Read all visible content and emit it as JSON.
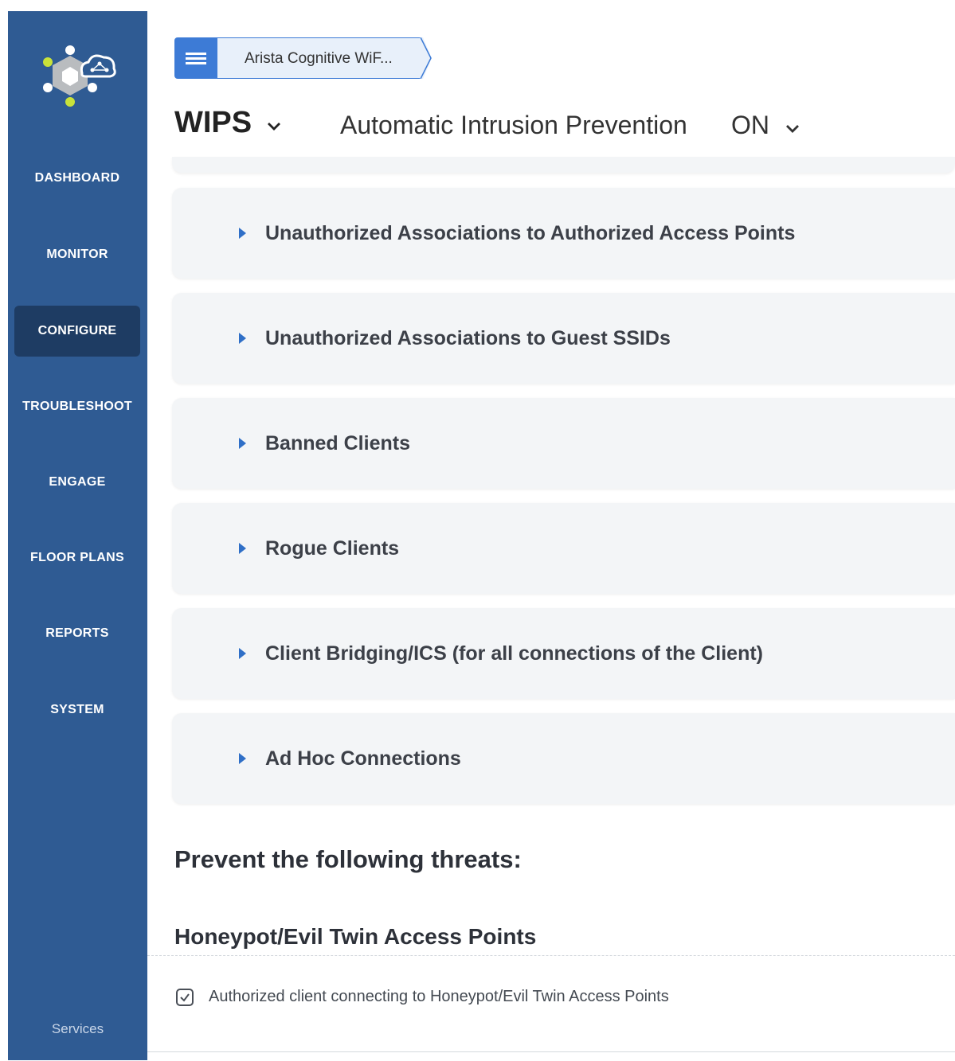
{
  "sidebar": {
    "logo_icon": "cloud-network-hexagon-logo",
    "items": [
      {
        "label": "DASHBOARD",
        "active": false
      },
      {
        "label": "MONITOR",
        "active": false
      },
      {
        "label": "CONFIGURE",
        "active": true
      },
      {
        "label": "TROUBLESHOOT",
        "active": false
      },
      {
        "label": "ENGAGE",
        "active": false
      },
      {
        "label": "FLOOR PLANS",
        "active": false
      },
      {
        "label": "REPORTS",
        "active": false
      },
      {
        "label": "SYSTEM",
        "active": false
      }
    ],
    "footer": "Services"
  },
  "breadcrumb": {
    "menu_icon": "hamburger-icon",
    "label": "Arista Cognitive WiF..."
  },
  "header": {
    "title": "WIPS",
    "subtitle": "Automatic Intrusion Prevention",
    "status": "ON"
  },
  "panels": [
    {
      "label": "Unauthorized Associations to Authorized Access Points"
    },
    {
      "label": "Unauthorized Associations to Guest SSIDs"
    },
    {
      "label": "Banned Clients"
    },
    {
      "label": "Rogue Clients"
    },
    {
      "label": "Client Bridging/ICS (for all connections of the Client)"
    },
    {
      "label": "Ad Hoc Connections"
    }
  ],
  "prevent": {
    "heading": "Prevent the following threats:",
    "section": "Honeypot/Evil Twin Access Points",
    "option": {
      "label": "Authorized client connecting to Honeypot/Evil Twin Access Points",
      "checked": true
    }
  },
  "colors": {
    "sidebar": "#2f5b93",
    "sidebar_active": "#1e3c63",
    "accent": "#3d7bd6",
    "panel_bg": "#f3f5f7"
  }
}
